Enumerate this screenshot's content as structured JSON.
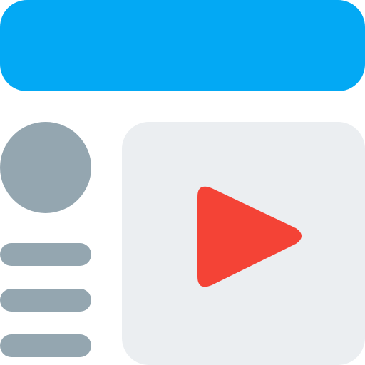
{
  "icon": {
    "name": "video-page-icon",
    "header_bar_color": "#03A9F4",
    "avatar_color": "#94A6B0",
    "text_line_color": "#94A6B0",
    "video_panel_color": "#EBEEF1",
    "play_button_color": "#F44336",
    "play_icon_name": "play-icon"
  }
}
